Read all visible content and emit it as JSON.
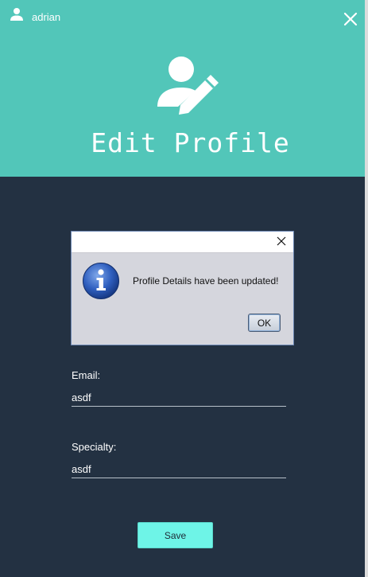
{
  "window": {
    "username": "adrian",
    "title": "Edit Profile"
  },
  "form": {
    "email_label": "Email:",
    "email_value": "asdf",
    "specialty_label": "Specialty:",
    "specialty_value": "asdf",
    "save_label": "Save"
  },
  "dialog": {
    "message": "Profile Details have been updated!",
    "ok_label": "OK"
  },
  "colors": {
    "header_bg": "#52c6b9",
    "body_bg": "#233142",
    "save_button_bg": "#6ef4e7"
  },
  "icons": [
    "user-icon",
    "close-icon",
    "edit-user-icon",
    "info-icon"
  ]
}
